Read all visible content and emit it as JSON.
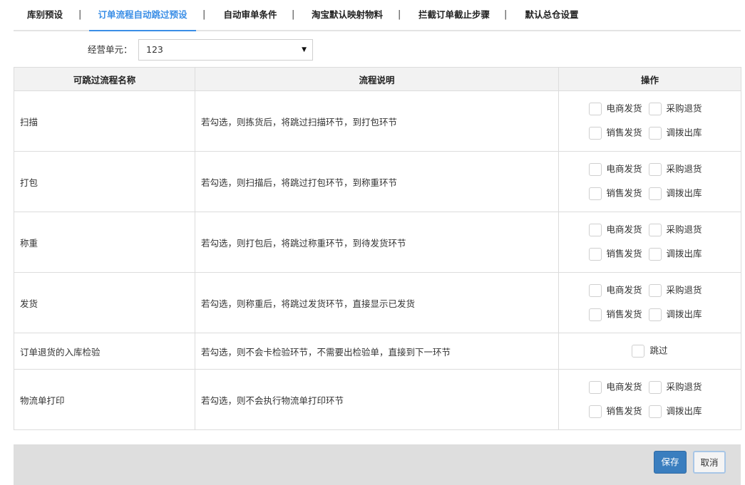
{
  "tabs": [
    {
      "label": "库别预设",
      "active": false
    },
    {
      "label": "订单流程自动跳过预设",
      "active": true
    },
    {
      "label": "自动审单条件",
      "active": false
    },
    {
      "label": "淘宝默认映射物料",
      "active": false
    },
    {
      "label": "拦截订单截止步骤",
      "active": false
    },
    {
      "label": "默认总仓设置",
      "active": false
    }
  ],
  "tab_separator": "|",
  "filter": {
    "label": "经营单元：",
    "value": "123"
  },
  "table": {
    "headers": [
      "可跳过流程名称",
      "流程说明",
      "操作"
    ],
    "option_labels": {
      "ecommerce": "电商发货",
      "purchase_return": "采购退货",
      "sales": "销售发货",
      "transfer": "调拨出库",
      "skip": "跳过"
    },
    "rows": [
      {
        "name": "扫描",
        "desc": "若勾选，则拣货后，将跳过扫描环节，到打包环节"
      },
      {
        "name": "打包",
        "desc": "若勾选，则扫描后，将跳过打包环节，到称重环节"
      },
      {
        "name": "称重",
        "desc": "若勾选，则打包后，将跳过称重环节，到待发货环节"
      },
      {
        "name": "发货",
        "desc": "若勾选，则称重后，将跳过发货环节，直接显示已发货"
      },
      {
        "name": "订单退货的入库检验",
        "desc": "若勾选，则不会卡检验环节，不需要出检验单，直接到下一环节"
      },
      {
        "name": "物流单打印",
        "desc": "若勾选，则不会执行物流单打印环节"
      }
    ]
  },
  "footer": {
    "save_label": "保存",
    "cancel_label": "取消"
  }
}
